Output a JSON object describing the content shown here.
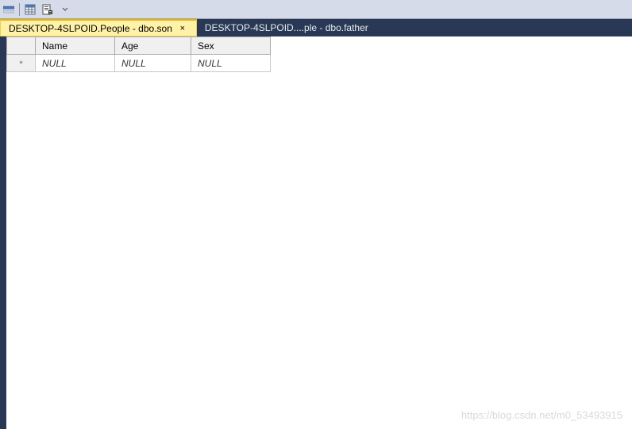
{
  "toolbar": {
    "icons": [
      "row-icon",
      "table-icon",
      "script-icon",
      "dropdown-arrow-icon"
    ]
  },
  "tabs": [
    {
      "label": "DESKTOP-4SLPOID.People - dbo.son",
      "active": true,
      "closeGlyph": "×"
    },
    {
      "label": "DESKTOP-4SLPOID....ple - dbo.father",
      "active": false,
      "closeGlyph": "×"
    }
  ],
  "grid": {
    "columns": [
      "Name",
      "Age",
      "Sex"
    ],
    "newRowMarker": "*",
    "nullText": "NULL",
    "rows": [
      {
        "isNew": true,
        "cells": [
          "NULL",
          "NULL",
          "NULL"
        ]
      }
    ]
  },
  "watermark": "https://blog.csdn.net/m0_53493915"
}
